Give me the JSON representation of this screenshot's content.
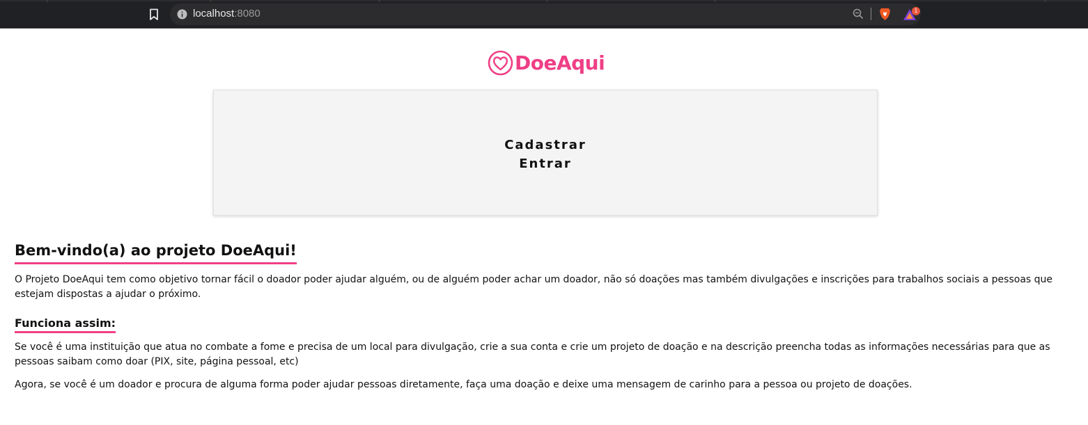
{
  "browser": {
    "url_host": "localhost",
    "url_port": ":8080",
    "rewards_badge": "1"
  },
  "logo": {
    "text": "DoeAqui",
    "icon": "heart-circle-icon"
  },
  "nav": {
    "items": [
      {
        "label": "Cadastrar"
      },
      {
        "label": "Entrar"
      }
    ]
  },
  "main": {
    "title": "Bem-vindo(a) ao projeto DoeAqui!",
    "intro": "O Projeto DoeAqui tem como objetivo tornar fácil o doador poder ajudar alguém, ou de alguém poder achar um doador, não só doações mas também divulgações e inscrições para trabalhos sociais a pessoas que estejam dispostas a ajudar o próximo.",
    "subtitle": "Funciona assim:",
    "paragraph_institution": "Se você é uma instituição que atua no combate a fome e precisa de um local para divulgação, crie a sua conta e crie um projeto de doação e na descrição preencha todas as informações necessárias para que as pessoas saibam como doar (PIX, site, página pessoal, etc)",
    "paragraph_donor": "Agora, se você é um doador e procura de alguma forma poder ajudar pessoas diretamente, faça uma doação e deixe uma mensagem de carinho para a pessoa ou projeto de doações."
  },
  "colors": {
    "brand": "#ef3f86",
    "chrome_bg": "#202124",
    "card_bg": "#f4f4f4"
  }
}
